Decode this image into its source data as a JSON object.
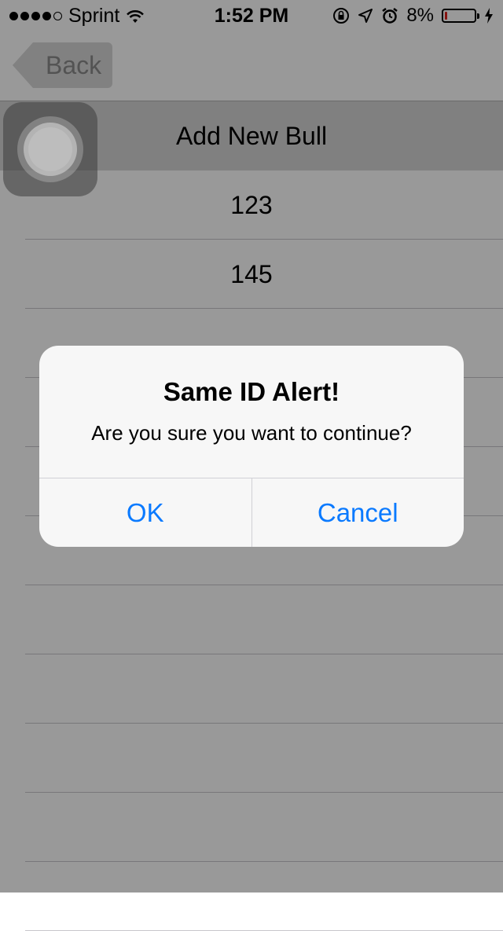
{
  "status_bar": {
    "carrier": "Sprint",
    "time": "1:52 PM",
    "battery_text": "8%",
    "battery_level": 0.08,
    "signal_bars_filled": 4,
    "signal_bars_total": 5,
    "icons": [
      "wifi-icon",
      "orientation-lock-icon",
      "location-icon",
      "alarm-icon",
      "battery-icon",
      "charging-bolt-icon"
    ]
  },
  "nav": {
    "back_label": "Back"
  },
  "table": {
    "header": "Add New Bull",
    "rows": [
      "123",
      "145",
      "",
      "",
      "",
      "",
      "",
      "",
      "",
      "",
      ""
    ]
  },
  "alert": {
    "title": "Same ID Alert!",
    "message": "Are you sure you want to continue?",
    "ok_label": "OK",
    "cancel_label": "Cancel"
  },
  "colors": {
    "alert_button": "#0a7aff",
    "battery_low": "#e0201c"
  }
}
